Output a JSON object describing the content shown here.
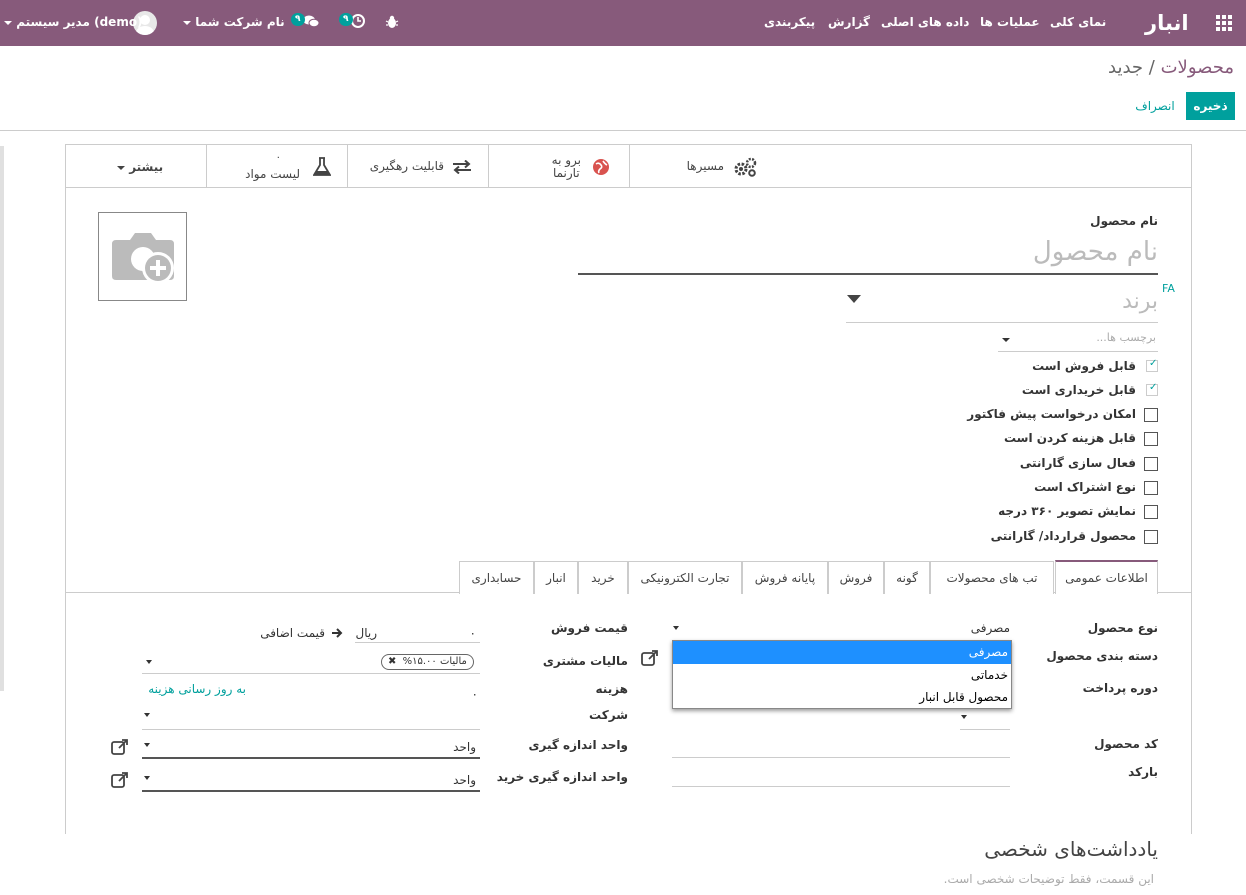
{
  "topbar": {
    "brand": "انبار",
    "menu": [
      "نمای کلی",
      "عملیات ها",
      "داده های اصلی",
      "گزارش",
      "پیکربندی"
    ],
    "chat_badge": "۹",
    "activity_badge": "۹",
    "company": "نام شرکت شما",
    "user": "مدیر سیستم (demo)",
    "icons": [
      "apps-icon",
      "chat-icon",
      "clock-icon",
      "bug-icon",
      "avatar"
    ]
  },
  "breadcrumb": {
    "parent": "محصولات",
    "separator": "/",
    "current": "جدید"
  },
  "buttons": {
    "save": "ذخیره",
    "discard": "انصراف"
  },
  "statbar": {
    "website": {
      "line1": "برو به",
      "line2": "تارنما"
    },
    "traceability": "قابلیت رهگیری",
    "bom": "لیست مواد",
    "bom_count": "۰",
    "routes": "مسیرها",
    "more": "بیشتر"
  },
  "form": {
    "name_label": "نام محصول",
    "name_placeholder": "نام محصول",
    "lang": "FA",
    "brand_placeholder": "برند",
    "tags_placeholder": "برچسب ها...",
    "checkboxes": [
      {
        "label": "قابل فروش است",
        "checked": true
      },
      {
        "label": "قابل خریداری است",
        "checked": true
      },
      {
        "label": "امکان درخواست پیش فاکتور",
        "checked": false
      },
      {
        "label": "قابل هزینه کردن است",
        "checked": false
      },
      {
        "label": "فعال سازی گارانتی",
        "checked": false
      },
      {
        "label": "نوع اشتراک است",
        "checked": false
      },
      {
        "label": "نمایش تصویر ۳۶۰ درجه",
        "checked": false
      },
      {
        "label": "محصول قرارداد/ گارانتی",
        "checked": false
      }
    ]
  },
  "tabs": [
    "اطلاعات عمومی",
    "تب های محصولات",
    "گونه",
    "فروش",
    "پایانه فروش",
    "تجارت الکترونیکی",
    "خرید",
    "انبار",
    "حسابداری"
  ],
  "general": {
    "product_type_label": "نوع محصول",
    "product_type_value": "مصرفی",
    "category_label": "دسته بندی محصول",
    "payment_label": "دوره پرداخت",
    "code_label": "کد محصول",
    "barcode_label": "بارکد",
    "price_label": "قیمت فروش",
    "price_value": "۰",
    "currency": "ریال",
    "extra_price": "قیمت اضافی",
    "customer_tax_label": "مالیات مشتری",
    "tax_tag": "مالیات ۱۵.۰۰%",
    "cost_label": "هزینه",
    "cost_value": "۰",
    "update_cost": "به روز رسانی هزینه",
    "company_label": "شرکت",
    "uom_label": "واحد اندازه گیری",
    "uom_value": "واحد",
    "purchase_uom_label": "واحد اندازه گیری خرید",
    "purchase_uom_value": "واحد"
  },
  "dropdown": {
    "options": [
      "مصرفی",
      "خدماتی",
      "محصول قابل انبار"
    ],
    "selected": "مصرفی"
  },
  "notes": {
    "title": "یادداشت‌های شخصی",
    "placeholder": "این قسمت، فقط توضیحات شخصی است."
  },
  "colors": {
    "brand": "#875A7B",
    "accent": "#00A09D",
    "selection": "#1E90FF"
  }
}
